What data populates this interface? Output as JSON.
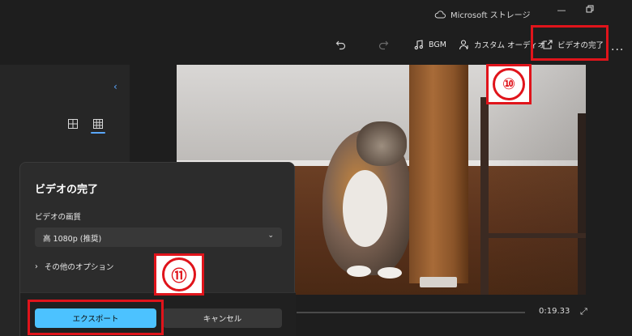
{
  "titlebar": {
    "storage_label": "Microsoft ストレージ",
    "cloud_icon": "cloud-icon",
    "minimize_icon": "minimize-icon",
    "restore_icon": "restore-icon"
  },
  "toolbar": {
    "undo_icon": "undo-icon",
    "redo_icon": "redo-icon",
    "bgm_label": "BGM",
    "custom_audio_label": "カスタム オーディオ",
    "finish_video_label": "ビデオの完了",
    "more_label": "..."
  },
  "callouts": {
    "ten": "⑩",
    "eleven": "⑪",
    "color": "#e0141b"
  },
  "dialog": {
    "title": "ビデオの完了",
    "quality_label": "ビデオの画質",
    "quality_value": "高 1080p (推奨)",
    "more_options": "その他のオプション",
    "export_label": "エクスポート",
    "cancel_label": "キャンセル",
    "accent": "#4cc2ff"
  },
  "playback": {
    "time": "0:19.33"
  }
}
